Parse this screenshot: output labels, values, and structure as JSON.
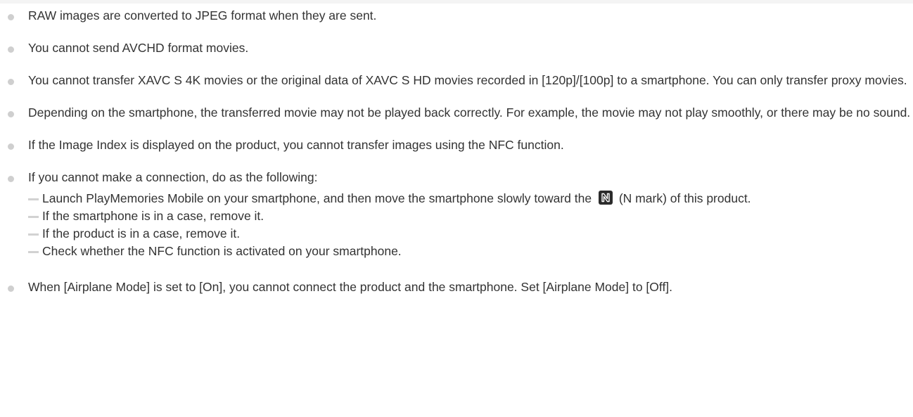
{
  "notes": [
    {
      "text": "RAW images are converted to JPEG format when they are sent."
    },
    {
      "text": "You cannot send AVCHD format movies."
    },
    {
      "text": "You cannot transfer XAVC S 4K movies or the original data of XAVC S HD movies recorded in [120p]/[100p] to a smartphone. You can only transfer proxy movies."
    },
    {
      "text": "Depending on the smartphone, the transferred movie may not be played back correctly. For example, the movie may not play smoothly, or there may be no sound."
    },
    {
      "text": "If the Image Index is displayed on the product, you cannot transfer images using the NFC function."
    },
    {
      "text": "If you cannot make a connection, do as the following:"
    },
    {
      "text": "When [Airplane Mode] is set to [On], you cannot connect the product and the smartphone. Set [Airplane Mode] to [Off]."
    }
  ],
  "sub_items": {
    "launch_before": "Launch PlayMemories Mobile on your smartphone, and then move the smartphone slowly toward the",
    "launch_after": "(N mark) of this product.",
    "case_phone": "If the smartphone is in a case, remove it.",
    "case_product": "If the product is in a case, remove it.",
    "check_nfc": "Check whether the NFC function is activated on your smartphone."
  },
  "icons": {
    "n_mark": "n-mark-icon",
    "bullet": "gray-dot",
    "dash": "gray-dash"
  },
  "colors": {
    "text": "#333333",
    "bullet": "#cfcfcf",
    "dash": "#d2d2d2",
    "n_mark_bg": "#2b2b2b"
  }
}
